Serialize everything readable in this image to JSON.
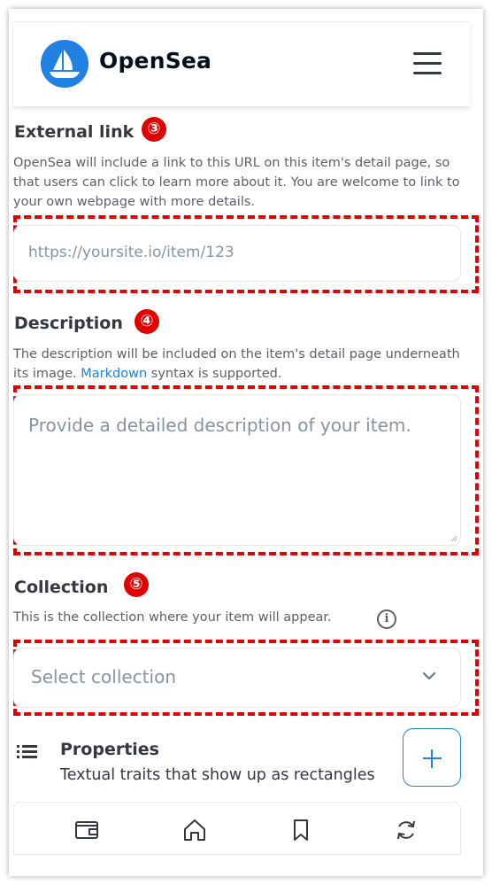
{
  "header": {
    "brand": "OpenSea",
    "logo_icon": "opensea-boat-icon",
    "menu_icon": "hamburger-icon"
  },
  "external_link": {
    "title": "External link",
    "marker": "③",
    "helper": "OpenSea will include a link to this URL on this item's detail page, so that users can click to learn more about it. You are welcome to link to your own webpage with more details.",
    "placeholder": "https://yoursite.io/item/123"
  },
  "description": {
    "title": "Description",
    "marker": "④",
    "helper_before": "The description will be included on the item's detail page underneath its image. ",
    "helper_link": "Markdown",
    "helper_after": " syntax is supported.",
    "placeholder": "Provide a detailed description of your item."
  },
  "collection": {
    "title": "Collection",
    "marker": "⑤",
    "helper": "This is the collection where your item will appear.",
    "info_icon": "info-icon",
    "select_placeholder": "Select collection"
  },
  "properties": {
    "title": "Properties",
    "subtitle": "Textual traits that show up as rectangles",
    "add_icon": "plus-icon"
  },
  "bottom_nav": {
    "items": [
      "wallet-icon",
      "home-icon",
      "bookmark-icon",
      "refresh-icon"
    ]
  },
  "colors": {
    "brand_blue": "#2081e2",
    "annotation_red": "#e00000",
    "text": "#353840",
    "muted": "#5c5f66"
  }
}
